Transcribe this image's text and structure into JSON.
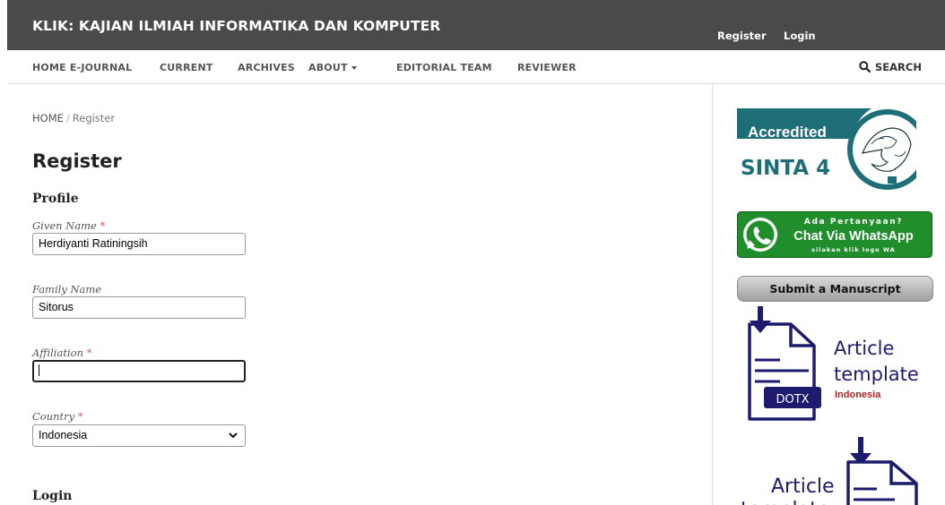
{
  "header": {
    "site_title": "KLIK: KAJIAN ILMIAH INFORMATIKA DAN KOMPUTER",
    "user_nav": {
      "register": "Register",
      "login": "Login"
    }
  },
  "nav": {
    "items": [
      {
        "label": "HOME E-JOURNAL"
      },
      {
        "label": "CURRENT"
      },
      {
        "label": "ARCHIVES"
      },
      {
        "label": "ABOUT",
        "has_dropdown": true
      },
      {
        "label": "EDITORIAL TEAM"
      },
      {
        "label": "REVIEWER"
      }
    ],
    "search_label": "SEARCH"
  },
  "breadcrumb": {
    "home": "HOME",
    "separator": "/",
    "current": "Register"
  },
  "page_title": "Register",
  "form": {
    "profile_legend": "Profile",
    "given_name": {
      "label": "Given Name",
      "required": "*",
      "value": "Herdiyanti Ratiningsih"
    },
    "family_name": {
      "label": "Family Name",
      "value": "Sitorus"
    },
    "affiliation": {
      "label": "Affiliation",
      "required": "*",
      "value": ""
    },
    "country": {
      "label": "Country",
      "required": "*",
      "selected": "Indonesia"
    },
    "login_legend": "Login"
  },
  "sidebar": {
    "accreditation": {
      "line1": "Accredited",
      "line2": "SINTA 4"
    },
    "whatsapp": {
      "line1": "Ada Pertanyaan?",
      "line2": "Chat Via WhatsApp",
      "line3": "silakan klik logo WA"
    },
    "submit_label": "Submit a Manuscript",
    "template_docx": {
      "line1": "Article",
      "line2": "template",
      "tag": "DOTX",
      "language": "Indonesia"
    },
    "template_second": {
      "line1": "Article",
      "line2": "template"
    }
  },
  "colors": {
    "header_bg": "#4a4a4a",
    "sinta_teal": "#1e6e78",
    "whatsapp_green": "#1f8e2b",
    "template_navy": "#1c1b6e",
    "required_red": "#d9534f"
  }
}
